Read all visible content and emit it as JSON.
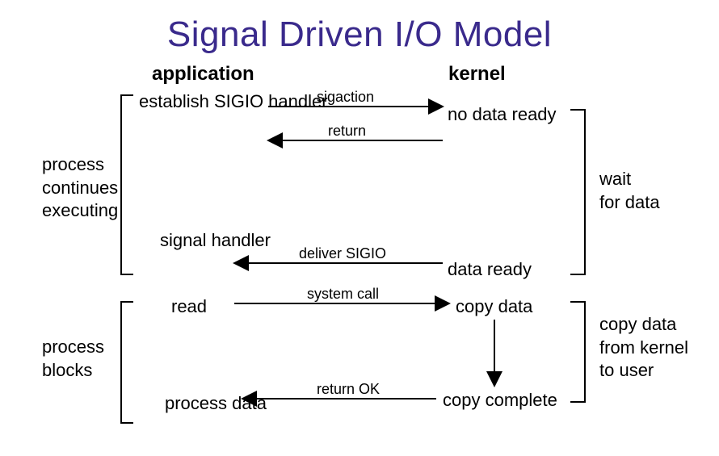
{
  "title": "Signal Driven I/O Model",
  "headers": {
    "app": "application",
    "kernel": "kernel"
  },
  "app": {
    "establish": "establish\nSIGIO handler",
    "signal_handler": "signal\nhandler",
    "read": "read",
    "process_data": "process\ndata"
  },
  "kernel": {
    "no_data_ready": "no data ready",
    "data_ready": "data ready",
    "copy_data": "copy data",
    "copy_complete": "copy complete"
  },
  "arrows": {
    "sigaction": "sigaction",
    "return": "return",
    "deliver_sigio": "deliver SIGIO",
    "system_call": "system call",
    "return_ok": "return OK"
  },
  "notes": {
    "process_continues": "process\ncontinues\nexecuting",
    "wait_for_data": "wait\nfor data",
    "process_blocks": "process\nblocks",
    "copy_to_user": "copy data\nfrom kernel\nto user"
  }
}
